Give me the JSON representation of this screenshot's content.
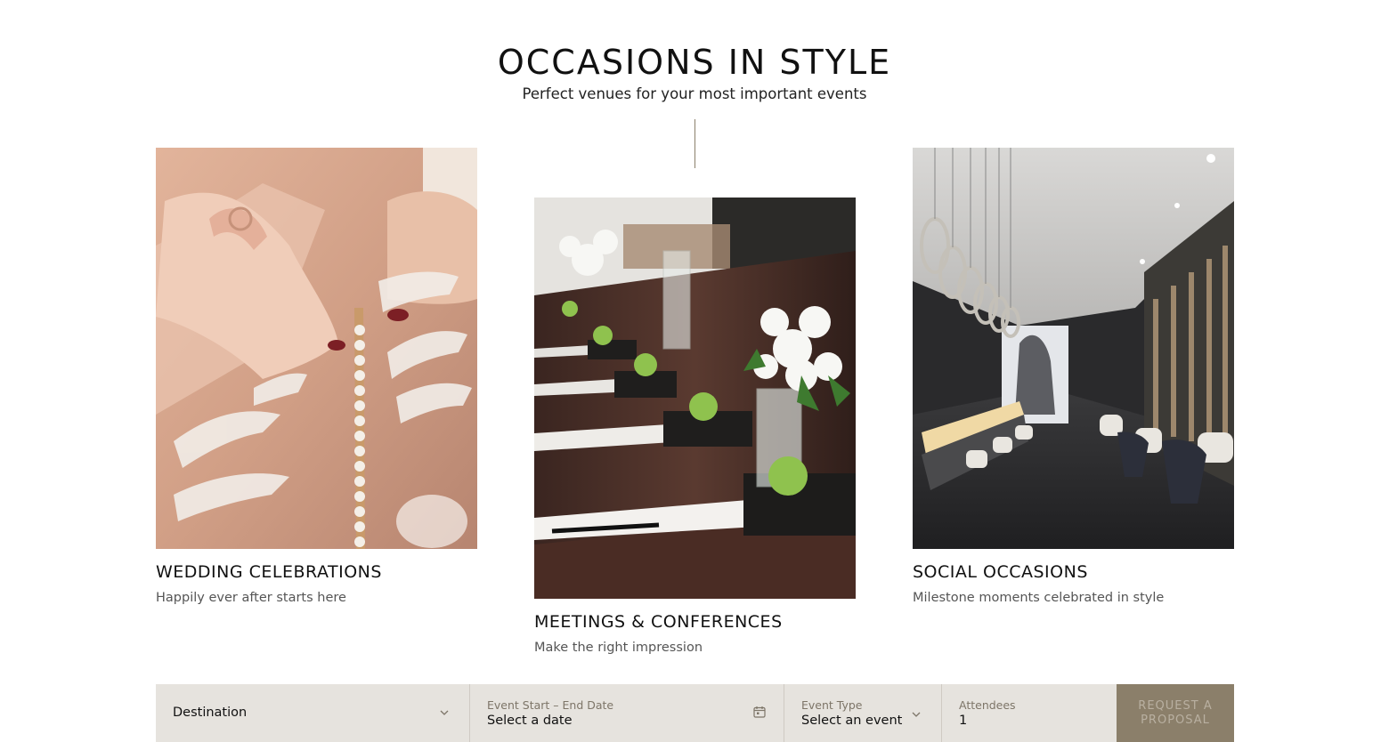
{
  "header": {
    "title": "OCCASIONS IN STYLE",
    "subtitle": "Perfect venues for your most important events"
  },
  "cards": [
    {
      "title": "WEDDING CELEBRATIONS",
      "description": "Happily ever after starts here"
    },
    {
      "title": "MEETINGS & CONFERENCES",
      "description": "Make the right impression"
    },
    {
      "title": "SOCIAL OCCASIONS",
      "description": "Milestone moments celebrated in style"
    }
  ],
  "booking_bar": {
    "destination": {
      "value": "Destination",
      "icon": "chevron-down-icon"
    },
    "date": {
      "label": "Event Start – End Date",
      "value": "Select a date",
      "icon": "calendar-icon"
    },
    "event_type": {
      "label": "Event Type",
      "value": "Select an event",
      "icon": "chevron-down-icon"
    },
    "attendees": {
      "label": "Attendees",
      "value": "1"
    },
    "submit_label": "REQUEST A PROPOSAL"
  },
  "colors": {
    "accent": "#8b7f6a",
    "bar_background": "#e6e3de",
    "label_text": "#7d7568"
  }
}
